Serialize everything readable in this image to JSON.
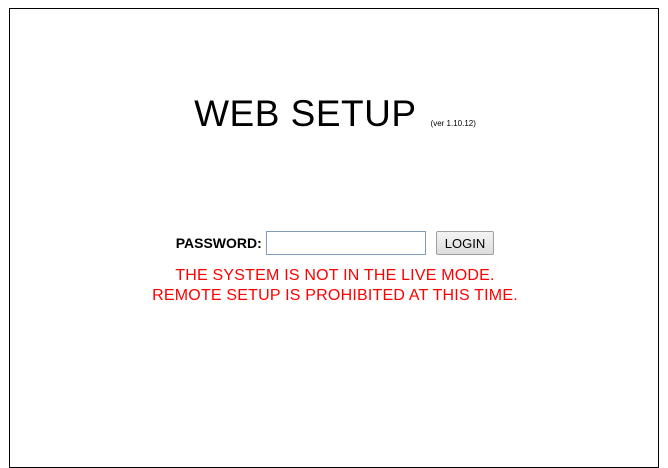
{
  "header": {
    "title": "WEB SETUP",
    "version": "(ver 1.10.12)"
  },
  "login": {
    "password_label": "PASSWORD:",
    "password_value": "",
    "login_button_label": "LOGIN"
  },
  "messages": {
    "line1": "THE SYSTEM IS NOT IN THE LIVE MODE.",
    "line2": "REMOTE SETUP IS PROHIBITED AT THIS TIME."
  },
  "colors": {
    "error_text": "#ff0000",
    "border": "#000000",
    "input_border": "#7f9db9"
  }
}
